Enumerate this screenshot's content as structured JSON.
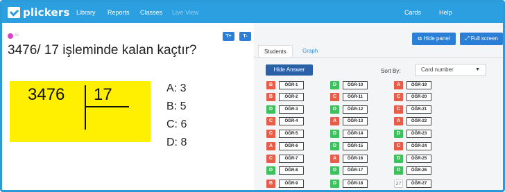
{
  "app": {
    "logo_text": "plickers",
    "nav": [
      {
        "label": "Library"
      },
      {
        "label": "Reports"
      },
      {
        "label": "Classes"
      },
      {
        "label": "Live View"
      },
      {
        "label": "Cards"
      },
      {
        "label": "Help"
      }
    ]
  },
  "question": {
    "tag": "SL",
    "text": "3476/ 17 işleminde kalan kaçtır?",
    "dividend": "3476",
    "divisor": "17",
    "toolbar_buttons": [
      "T+",
      "T-"
    ],
    "options": [
      {
        "label": "A: 3"
      },
      {
        "label": "B: 5"
      },
      {
        "label": "C: 6"
      },
      {
        "label": "D: 8"
      }
    ]
  },
  "panel": {
    "hide_panel": "Hide panel",
    "full_screen": "Full screen",
    "tabs": [
      {
        "label": "Students",
        "active": true
      },
      {
        "label": "Graph",
        "active": false
      }
    ],
    "hide_answer": "Hide Answer",
    "sort_by_label": "Sort By:",
    "sort_by_value": "Card number",
    "students": [
      {
        "answer": "B",
        "name": "ÖĞR-1"
      },
      {
        "answer": "B",
        "name": "ÖĞR-2"
      },
      {
        "answer": "D",
        "name": "ÖĞR-3"
      },
      {
        "answer": "C",
        "name": "ÖĞR-4"
      },
      {
        "answer": "C",
        "name": "ÖĞR-5"
      },
      {
        "answer": "A",
        "name": "ÖĞR-6"
      },
      {
        "answer": "C",
        "name": "ÖĞR-7"
      },
      {
        "answer": "D",
        "name": "ÖĞR-8"
      },
      {
        "answer": "B",
        "name": "ÖĞR-9"
      },
      {
        "answer": "D",
        "name": "ÖĞR-10"
      },
      {
        "answer": "C",
        "name": "ÖĞR-11"
      },
      {
        "answer": "D",
        "name": "ÖĞR-12"
      },
      {
        "answer": "A",
        "name": "ÖĞR-13"
      },
      {
        "answer": "D",
        "name": "ÖĞR-14"
      },
      {
        "answer": "D",
        "name": "ÖĞR-15"
      },
      {
        "answer": "A",
        "name": "ÖĞR-16"
      },
      {
        "answer": "D",
        "name": "ÖĞR-17"
      },
      {
        "answer": "D",
        "name": "ÖĞR-18"
      },
      {
        "answer": "A",
        "name": "ÖĞR-19"
      },
      {
        "answer": "C",
        "name": "ÖĞR-20"
      },
      {
        "answer": "C",
        "name": "ÖĞR-21"
      },
      {
        "answer": "A",
        "name": "ÖĞR-22"
      },
      {
        "answer": "D",
        "name": "ÖĞR-23"
      },
      {
        "answer": "C",
        "name": "ÖĞR-24"
      },
      {
        "answer": "D",
        "name": "ÖĞR-25"
      },
      {
        "answer": "D",
        "name": "ÖĞR-26"
      },
      {
        "answer": "27",
        "name": "ÖĞR-27"
      }
    ]
  },
  "colors": {
    "nav_bg": "#2b9fe0",
    "button_blue": "#2b7fd6",
    "wrong": "#e85c4a",
    "correct": "#3cc25c",
    "highlight": "#ffef00"
  }
}
